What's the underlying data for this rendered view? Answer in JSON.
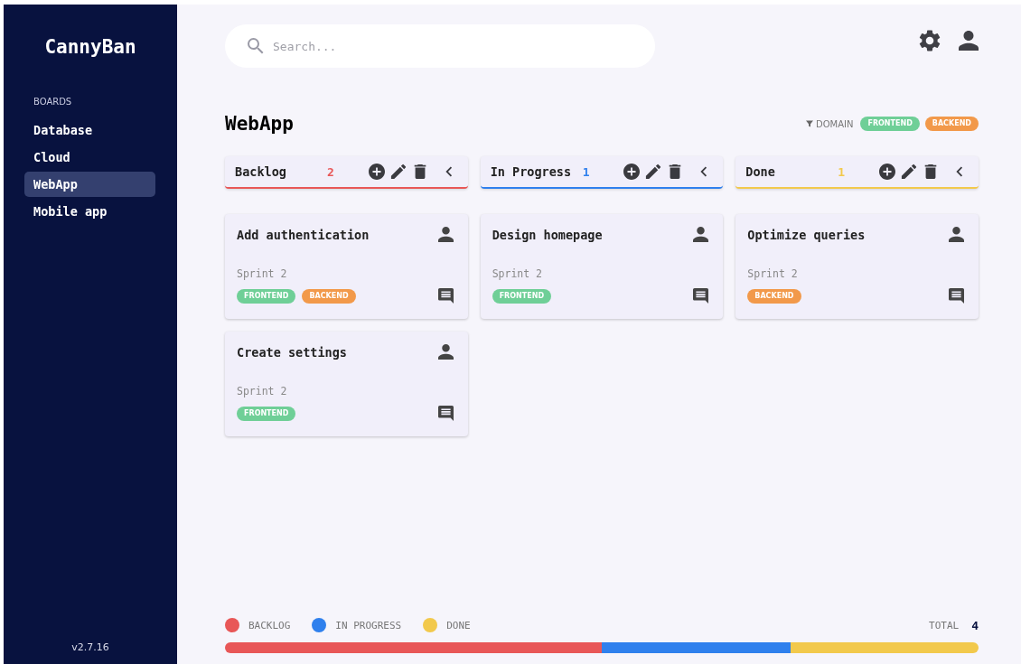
{
  "sidebar": {
    "logo": "CannyBan",
    "section": "BOARDS",
    "items": [
      {
        "label": "Database",
        "selected": false
      },
      {
        "label": "Cloud",
        "selected": false
      },
      {
        "label": "WebApp",
        "selected": true
      },
      {
        "label": "Mobile app",
        "selected": false
      }
    ],
    "version": "v2.7.16"
  },
  "search": {
    "placeholder": "Search..."
  },
  "board": {
    "title": "WebApp",
    "filter": {
      "label": "DOMAIN",
      "tags": [
        {
          "label": "FRONTEND",
          "kind": "frontend"
        },
        {
          "label": "BACKEND",
          "kind": "backend"
        }
      ]
    }
  },
  "columns": [
    {
      "name": "Backlog",
      "count": "2",
      "color": "#e85757",
      "cards": [
        {
          "title": "Add authentication",
          "sprint": "Sprint 2",
          "tags": [
            {
              "label": "FRONTEND",
              "kind": "frontend"
            },
            {
              "label": "BACKEND",
              "kind": "backend"
            }
          ]
        },
        {
          "title": "Create settings",
          "sprint": "Sprint 2",
          "tags": [
            {
              "label": "FRONTEND",
              "kind": "frontend"
            }
          ]
        }
      ]
    },
    {
      "name": "In Progress",
      "count": "1",
      "color": "#2f80ed",
      "cards": [
        {
          "title": "Design homepage",
          "sprint": "Sprint 2",
          "tags": [
            {
              "label": "FRONTEND",
              "kind": "frontend"
            }
          ]
        }
      ]
    },
    {
      "name": "Done",
      "count": "1",
      "color": "#f2c94c",
      "cards": [
        {
          "title": "Optimize queries",
          "sprint": "Sprint 2",
          "tags": [
            {
              "label": "BACKEND",
              "kind": "backend"
            }
          ]
        }
      ]
    }
  ],
  "summary": {
    "legend": [
      {
        "label": "BACKLOG",
        "color": "#e85757"
      },
      {
        "label": "IN PROGRESS",
        "color": "#2f80ed"
      },
      {
        "label": "DONE",
        "color": "#f2c94c"
      }
    ],
    "total_label": "TOTAL",
    "total": "4"
  }
}
